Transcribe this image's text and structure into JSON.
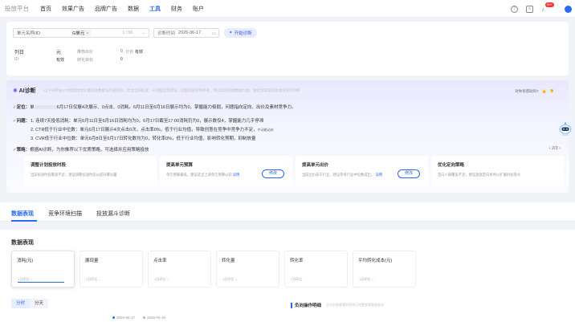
{
  "nav": {
    "logo": "投放平台",
    "items": [
      "首页",
      "效果广告",
      "品牌广告",
      "数据",
      "工具",
      "财务",
      "账户"
    ],
    "badge": "99+"
  },
  "filter": {
    "unit_label": "单元名称/ID",
    "selected_tag": "G单元",
    "count": "1 / 50",
    "date_label": "诊断时间",
    "date_value": "2026-06-17",
    "start_btn": "开始诊断",
    "info": {
      "a": "列日",
      "b": "元",
      "c": "推荐出价",
      "d": "0",
      "e": "计划",
      "f": "有效",
      "g": "ID:",
      "h": "有效",
      "i": "转化目标",
      "j": "0"
    }
  },
  "ai": {
    "title": "AI诊断",
    "desc": "以下诊断由AI大模型结合大量投放数据与历史经验，结合当前投放，AI可能出现错误，回复内容仅供参考，请以实际投放数据为准，请结合实际投放情况进行判断",
    "feedback": "对你有帮助吗?",
    "position_head": "定位：",
    "position_pre": "单",
    "position_text": "6月17日仅展4次展示、0点击、0消耗。6月11日至6月16日展示均为0，掌握能力极弱，问题指向定向、出价及素材竞争力。",
    "problem_head": "问题：",
    "problems": [
      "1. 连续7天投低消耗：单元6月11日至6月16日消耗均为0，6月17日截至17:00消耗仍为0，展示数仅4，掌握能力几乎停滞",
      "2. CTR低于行业中位数：单元6月17日展示4次点击0次，点击率0%，低于行业均值，导致创意在竞争中竞争力不足，",
      "3. CVR低于行业中位数：单元6月8日至6月17日转化数均为0，转化率0%，低于行业均值，影响转化预期，抑制放量"
    ],
    "problem_tail": "中动能动态",
    "problem_tail2": "抑制放量",
    "strategy_head": "策略：",
    "strategy_text": "根据AI诊断，为你推荐以下优质策略，可选择并应用策略投放",
    "pager": "2/3",
    "cards": [
      {
        "title": "调整计划投放时段",
        "desc": "当前投放时段覆盖不足，建议调整投放时段以提升曝光量",
        "btn": ""
      },
      {
        "title": "提高单元预算",
        "desc": "单元预算偏低，建议适当上调单元预算以获",
        "link": "详情",
        "btn": "修改"
      },
      {
        "title": "提高单元出价",
        "desc": "当前出价低于行业，建议参考行业中位数提出，",
        "link": "详情",
        "btn": "修改"
      },
      {
        "title": "优化定向策略",
        "desc": "定向人群覆盖不足，建议放宽定向条件以扩展目标受众",
        "btn": ""
      },
      {
        "title": "优",
        "desc": "",
        "btn": ""
      }
    ]
  },
  "tabs": [
    "数据表现",
    "竞争环境扫描",
    "投放漏斗诊断"
  ],
  "data": {
    "title": "数据表现",
    "metrics": [
      {
        "label": "消耗(元)",
        "sub": "1日环比 --"
      },
      {
        "label": "展现量",
        "sub": "1日环比 --"
      },
      {
        "label": "点击率",
        "sub": "1日环比 --"
      },
      {
        "label": "转化量",
        "sub": "1日环比 --"
      },
      {
        "label": "转化率",
        "sub": "1日环比 --"
      },
      {
        "label": "平均转化成本(元)",
        "sub": "1日环比 --"
      }
    ],
    "toggle": [
      "分时",
      "分天"
    ],
    "legend": [
      "2026-06-17",
      "2026-06-16"
    ],
    "oplog": "负向操作明细",
    "oplog_sub": "点击右侧查看时间线可完整查看数据变动"
  },
  "colors": {
    "accent": "#2a6af5",
    "ai_purple": "#6b5cf0",
    "badge": "#ff3333"
  }
}
